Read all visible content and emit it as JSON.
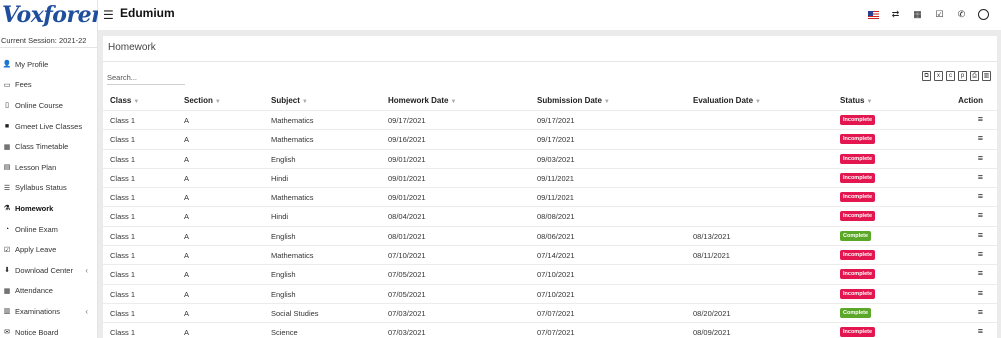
{
  "brand": {
    "logo_text": "Voxforem",
    "app_title": "Edumium"
  },
  "session": "Current Session: 2021-22",
  "sidebar": {
    "items": [
      {
        "label": "My Profile",
        "icon": "user-icon"
      },
      {
        "label": "Fees",
        "icon": "money-icon"
      },
      {
        "label": "Online Course",
        "icon": "file-icon"
      },
      {
        "label": "Gmeet Live Classes",
        "icon": "video-icon"
      },
      {
        "label": "Class Timetable",
        "icon": "calendar-icon"
      },
      {
        "label": "Lesson Plan",
        "icon": "list-icon"
      },
      {
        "label": "Syllabus Status",
        "icon": "bulleted-list-icon"
      },
      {
        "label": "Homework",
        "icon": "flask-icon",
        "active": true
      },
      {
        "label": "Online Exam",
        "icon": "rss-icon"
      },
      {
        "label": "Apply Leave",
        "icon": "check-square-icon"
      },
      {
        "label": "Download Center",
        "icon": "download-icon",
        "expandable": true
      },
      {
        "label": "Attendance",
        "icon": "calendar-check-icon"
      },
      {
        "label": "Examinations",
        "icon": "map-icon",
        "expandable": true
      },
      {
        "label": "Notice Board",
        "icon": "envelope-icon"
      }
    ]
  },
  "topbar": {
    "icons": [
      "us-flag-icon",
      "exchange-icon",
      "calendar-icon",
      "tasks-icon",
      "whatsapp-icon",
      "user-avatar-icon"
    ]
  },
  "page": {
    "title": "Homework",
    "search_placeholder": "Search...",
    "toolbar_icons": [
      "copy-icon",
      "excel-icon",
      "csv-icon",
      "pdf-icon",
      "print-icon",
      "columns-icon"
    ]
  },
  "table": {
    "headers": {
      "class": "Class",
      "section": "Section",
      "subject": "Subject",
      "homework_date": "Homework Date",
      "submission_date": "Submission Date",
      "evaluation_date": "Evaluation Date",
      "status": "Status",
      "action": "Action"
    },
    "rows": [
      {
        "class": "Class 1",
        "section": "A",
        "subject": "Mathematics",
        "homework_date": "09/17/2021",
        "submission_date": "09/17/2021",
        "evaluation_date": "",
        "status": "Incomplete"
      },
      {
        "class": "Class 1",
        "section": "A",
        "subject": "Mathematics",
        "homework_date": "09/16/2021",
        "submission_date": "09/17/2021",
        "evaluation_date": "",
        "status": "Incomplete"
      },
      {
        "class": "Class 1",
        "section": "A",
        "subject": "English",
        "homework_date": "09/01/2021",
        "submission_date": "09/03/2021",
        "evaluation_date": "",
        "status": "Incomplete"
      },
      {
        "class": "Class 1",
        "section": "A",
        "subject": "Hindi",
        "homework_date": "09/01/2021",
        "submission_date": "09/11/2021",
        "evaluation_date": "",
        "status": "Incomplete"
      },
      {
        "class": "Class 1",
        "section": "A",
        "subject": "Mathematics",
        "homework_date": "09/01/2021",
        "submission_date": "09/11/2021",
        "evaluation_date": "",
        "status": "Incomplete"
      },
      {
        "class": "Class 1",
        "section": "A",
        "subject": "Hindi",
        "homework_date": "08/04/2021",
        "submission_date": "08/08/2021",
        "evaluation_date": "",
        "status": "Incomplete"
      },
      {
        "class": "Class 1",
        "section": "A",
        "subject": "English",
        "homework_date": "08/01/2021",
        "submission_date": "08/06/2021",
        "evaluation_date": "08/13/2021",
        "status": "Complete"
      },
      {
        "class": "Class 1",
        "section": "A",
        "subject": "Mathematics",
        "homework_date": "07/10/2021",
        "submission_date": "07/14/2021",
        "evaluation_date": "08/11/2021",
        "status": "Incomplete"
      },
      {
        "class": "Class 1",
        "section": "A",
        "subject": "English",
        "homework_date": "07/05/2021",
        "submission_date": "07/10/2021",
        "evaluation_date": "",
        "status": "Incomplete"
      },
      {
        "class": "Class 1",
        "section": "A",
        "subject": "English",
        "homework_date": "07/05/2021",
        "submission_date": "07/10/2021",
        "evaluation_date": "",
        "status": "Incomplete"
      },
      {
        "class": "Class 1",
        "section": "A",
        "subject": "Social Studies",
        "homework_date": "07/03/2021",
        "submission_date": "07/07/2021",
        "evaluation_date": "08/20/2021",
        "status": "Complete"
      },
      {
        "class": "Class 1",
        "section": "A",
        "subject": "Science",
        "homework_date": "07/03/2021",
        "submission_date": "07/07/2021",
        "evaluation_date": "08/09/2021",
        "status": "Incomplete"
      }
    ]
  },
  "colors": {
    "incomplete": "#e3164f",
    "complete": "#5ba828",
    "brand": "#1f4e9c"
  }
}
